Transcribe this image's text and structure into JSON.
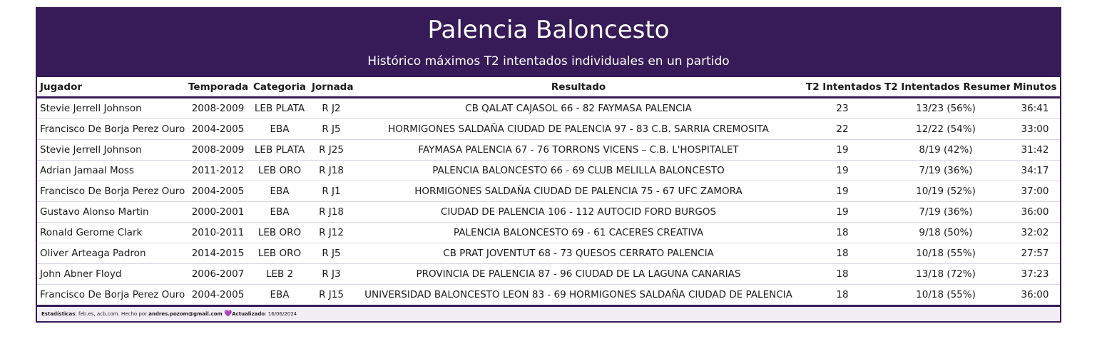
{
  "header": {
    "title": "Palencia Baloncesto",
    "subtitle": "Histórico máximos T2 intentados individuales en un partido"
  },
  "columns": [
    "Jugador",
    "Temporada",
    "Categoria",
    "Jornada",
    "Resultado",
    "T2 Intentados",
    "T2 Intentados Resumen",
    "Minutos"
  ],
  "rows": [
    [
      "Stevie Jerrell Johnson",
      "2008-2009",
      "LEB PLATA",
      "R J2",
      "CB QALAT CAJASOL 66 - 82 FAYMASA PALENCIA",
      "23",
      "13/23 (56%)",
      "36:41"
    ],
    [
      "Francisco De Borja Perez Ouro",
      "2004-2005",
      "EBA",
      "R J5",
      "HORMIGONES SALDAÑA CIUDAD DE PALENCIA 97 - 83 C.B. SARRIA CREMOSITA",
      "22",
      "12/22 (54%)",
      "33:00"
    ],
    [
      "Stevie Jerrell Johnson",
      "2008-2009",
      "LEB PLATA",
      "R J25",
      "FAYMASA PALENCIA 67 - 76 TORRONS VICENS – C.B. L'HOSPITALET",
      "19",
      "8/19 (42%)",
      "31:42"
    ],
    [
      "Adrian Jamaal Moss",
      "2011-2012",
      "LEB ORO",
      "R J18",
      "PALENCIA BALONCESTO 66 - 69 CLUB MELILLA BALONCESTO",
      "19",
      "7/19 (36%)",
      "34:17"
    ],
    [
      "Francisco De Borja Perez Ouro",
      "2004-2005",
      "EBA",
      "R J1",
      "HORMIGONES SALDAÑA CIUDAD DE PALENCIA 75 - 67 UFC ZAMORA",
      "19",
      "10/19 (52%)",
      "37:00"
    ],
    [
      "Gustavo Alonso Martin",
      "2000-2001",
      "EBA",
      "R J18",
      "CIUDAD DE PALENCIA 106 - 112 AUTOCID FORD BURGOS",
      "19",
      "7/19 (36%)",
      "36:00"
    ],
    [
      "Ronald Gerome Clark",
      "2010-2011",
      "LEB ORO",
      "R J12",
      "PALENCIA BALONCESTO 69 - 61 CACERES CREATIVA",
      "18",
      "9/18 (50%)",
      "32:02"
    ],
    [
      "Oliver Arteaga Padron",
      "2014-2015",
      "LEB ORO",
      "R J5",
      "CB PRAT JOVENTUT 68 - 73 QUESOS CERRATO PALENCIA",
      "18",
      "10/18 (55%)",
      "27:57"
    ],
    [
      "John Abner Floyd",
      "2006-2007",
      "LEB 2",
      "R J3",
      "PROVINCIA DE PALENCIA 87 - 96 CIUDAD DE LA LAGUNA CANARIAS",
      "18",
      "13/18 (72%)",
      "37:23"
    ],
    [
      "Francisco De Borja Perez Ouro",
      "2004-2005",
      "EBA",
      "R J15",
      "UNIVERSIDAD BALONCESTO LEON 83 - 69 HORMIGONES SALDAÑA CIUDAD DE PALENCIA",
      "18",
      "10/18 (55%)",
      "36:00"
    ]
  ],
  "footer": {
    "stats_label": "Estadísticas",
    "stats_text": ": feb.es, acb.com. Hecho por ",
    "author": "andres.pozom@gmail.com",
    "heart": "💜",
    "updated_label": "Actualizado",
    "updated_text": ": 16/06/2024"
  },
  "colors": {
    "header_bg": "#371b58",
    "accent": "#371b58"
  }
}
